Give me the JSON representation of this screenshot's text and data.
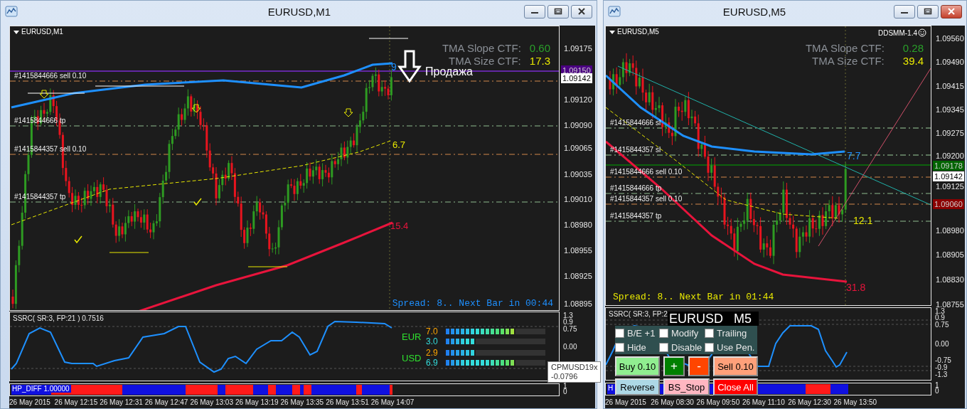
{
  "windows": [
    {
      "title": "EURUSD,M1",
      "chart": {
        "symbol_label": "EURUSD,M1",
        "tma": [
          {
            "label": "TMA Slope CTF:",
            "value": "0.60"
          },
          {
            "label": "TMA Size CTF:",
            "value": "17.3"
          }
        ],
        "annotations": [
          {
            "text": "9",
            "color": "#1e90ff"
          },
          {
            "text": "Продажа",
            "color": "#ffffff"
          },
          {
            "text": "6.7",
            "color": "#e8e800"
          },
          {
            "text": "15.4",
            "color": "#e8143c"
          }
        ],
        "order_lines": [
          {
            "kind": "entry",
            "text": "#1415844666 sell 0.10"
          },
          {
            "kind": "tp",
            "text": "#1415844666 tp"
          },
          {
            "kind": "entry",
            "text": "#1415844357 sell 0.10"
          },
          {
            "kind": "tp",
            "text": "#1415844357 tp"
          }
        ],
        "price_axis": [
          {
            "kind": "tick",
            "text": "1.09175"
          },
          {
            "kind": "marker",
            "text": "1.09150",
            "color": "#4b0082"
          },
          {
            "kind": "bid",
            "text": "1.09142"
          },
          {
            "kind": "tick",
            "text": "1.09120"
          },
          {
            "kind": "tick",
            "text": "1.09090"
          },
          {
            "kind": "tick",
            "text": "1.09065"
          },
          {
            "kind": "tick",
            "text": "1.09035"
          },
          {
            "kind": "tick",
            "text": "1.09010"
          },
          {
            "kind": "tick",
            "text": "1.08980"
          },
          {
            "kind": "tick",
            "text": "1.08955"
          },
          {
            "kind": "tick",
            "text": "1.08925"
          },
          {
            "kind": "tick",
            "text": "1.08895"
          }
        ],
        "status": "Spread: 8.. Next Bar in 00:44"
      },
      "indicator": {
        "label": "SSRC( SR:3, FP:21 ) 0.7516",
        "axis": [
          "1.3",
          "0.9",
          "0.75",
          "0.00"
        ]
      },
      "strength": [
        {
          "currency": "EUR",
          "rows": [
            {
              "value": "7.0",
              "level": 0.7
            },
            {
              "value": "3.0",
              "level": 0.3
            }
          ]
        },
        {
          "currency": "USD",
          "rows": [
            {
              "value": "2.9",
              "level": 0.3
            },
            {
              "value": "6.9",
              "level": 0.7
            }
          ]
        }
      ],
      "tooltip": [
        "CPMUSD19x",
        "-0.0796"
      ],
      "hp_diff": {
        "label": "HP_DIFF 1.00000",
        "axis": [
          "1",
          "0"
        ]
      },
      "time_axis": [
        "26 May 2015",
        "26 May 12:15",
        "26 May 12:31",
        "26 May 12:47",
        "26 May 13:03",
        "26 May 13:19",
        "26 May 13:35",
        "26 May 13:51",
        "26 May 14:07"
      ]
    },
    {
      "title": "EURUSD,M5",
      "chart": {
        "symbol_label": "EURUSD,M5",
        "badge": "DDSMM-1.4",
        "tma": [
          {
            "label": "TMA Slope CTF:",
            "value": "0.28"
          },
          {
            "label": "TMA Size CTF:",
            "value": "39.4"
          }
        ],
        "annotations": [
          {
            "text": "7.7",
            "color": "#1e90ff"
          },
          {
            "text": "12.1",
            "color": "#e8e800"
          },
          {
            "text": "31.8",
            "color": "#e8143c"
          }
        ],
        "order_lines": [
          {
            "kind": "sl",
            "text": "#1415844666 sl"
          },
          {
            "kind": "sl",
            "text": "#1415844357 sl"
          },
          {
            "kind": "entry",
            "text": "#1415844666 sell 0.10"
          },
          {
            "kind": "tp",
            "text": "#1415844666 tp"
          },
          {
            "kind": "entry",
            "text": "#1415844357 sell 0.10"
          },
          {
            "kind": "tp",
            "text": "#1415844357 tp"
          }
        ],
        "price_axis": [
          {
            "kind": "tick",
            "text": "1.09560"
          },
          {
            "kind": "tick",
            "text": "1.09490"
          },
          {
            "kind": "tick",
            "text": "1.09415"
          },
          {
            "kind": "tick",
            "text": "1.09345"
          },
          {
            "kind": "tick",
            "text": "1.09275"
          },
          {
            "kind": "tick",
            "text": "1.09200"
          },
          {
            "kind": "marker",
            "text": "1.09178",
            "color": "#006400"
          },
          {
            "kind": "bid",
            "text": "1.09142"
          },
          {
            "kind": "tick",
            "text": "1.09125"
          },
          {
            "kind": "marker",
            "text": "1.09060",
            "color": "#8b0000"
          },
          {
            "kind": "tick",
            "text": "1.08980"
          },
          {
            "kind": "tick",
            "text": "1.08905"
          },
          {
            "kind": "tick",
            "text": "1.08830"
          },
          {
            "kind": "tick",
            "text": "1.08755"
          }
        ],
        "status": "Spread: 8.. Next Bar in 01:44"
      },
      "indicator": {
        "label": "SSRC( SR:3, FP:2",
        "axis": [
          "1.3",
          "0.9",
          "0.75",
          "0.00",
          "-0.75",
          "-0.9",
          "-1.3"
        ]
      },
      "panel": {
        "title": "EURUSD   M5",
        "options": [
          {
            "label": "B/E +1",
            "checked": false
          },
          {
            "label": "Modify",
            "checked": false
          },
          {
            "label": "Trailing",
            "checked": false
          },
          {
            "label": "Hide",
            "checked": false
          },
          {
            "label": "Disable",
            "checked": false
          },
          {
            "label": "Use Pen.",
            "checked": false
          }
        ],
        "buttons": [
          {
            "kind": "buy",
            "label": "Buy 0.10"
          },
          {
            "kind": "plus",
            "label": "+"
          },
          {
            "kind": "minus",
            "label": "-"
          },
          {
            "kind": "sell",
            "label": "Sell 0.10"
          },
          {
            "kind": "reverse",
            "label": "Reverse"
          },
          {
            "kind": "stop",
            "label": "BS_Stop"
          },
          {
            "kind": "close",
            "label": "Close All"
          }
        ]
      },
      "hp_diff": {
        "label": "H",
        "axis": [
          "1",
          "0"
        ]
      },
      "time_axis": [
        "26 May 2015",
        "26 May 08:30",
        "26 May 09:50",
        "26 May 11:10",
        "26 May 12:30",
        "26 May 13:50"
      ]
    }
  ]
}
